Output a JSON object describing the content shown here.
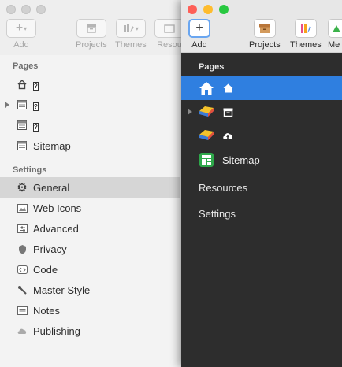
{
  "left_window": {
    "toolbar": {
      "add_label": "Add",
      "projects_label": "Projects",
      "themes_label": "Themes",
      "resources_label": "Resou"
    },
    "pages_header": "Pages",
    "pages": [
      {
        "icon": "home-icon",
        "label": "?"
      },
      {
        "icon": "page-icon",
        "label": "?"
      },
      {
        "icon": "page-icon",
        "label": "?"
      },
      {
        "icon": "sitemap-icon",
        "label": "Sitemap"
      }
    ],
    "settings_header": "Settings",
    "settings": [
      {
        "icon": "gear-icon",
        "label": "General"
      },
      {
        "icon": "image-icon",
        "label": "Web Icons"
      },
      {
        "icon": "sliders-icon",
        "label": "Advanced"
      },
      {
        "icon": "shield-icon",
        "label": "Privacy"
      },
      {
        "icon": "code-icon",
        "label": "Code"
      },
      {
        "icon": "brush-icon",
        "label": "Master Style"
      },
      {
        "icon": "notes-icon",
        "label": "Notes"
      },
      {
        "icon": "cloud-icon",
        "label": "Publishing"
      }
    ],
    "selected_setting": "General"
  },
  "right_window": {
    "toolbar": {
      "add_label": "Add",
      "projects_label": "Projects",
      "themes_label": "Themes",
      "more_label": "Me"
    },
    "pages_header": "Pages",
    "pages": [
      {
        "icon": "home-icon",
        "secondary_icon": "home-small-icon"
      },
      {
        "icon": "gem-stack-icon",
        "secondary_icon": "archive-icon"
      },
      {
        "icon": "gem-stack-icon",
        "secondary_icon": "cloud-upload-icon"
      },
      {
        "icon": "sitemap-icon",
        "label": "Sitemap"
      }
    ],
    "links": [
      "Resources",
      "Settings"
    ],
    "accent_color": "#2f7fe0"
  }
}
